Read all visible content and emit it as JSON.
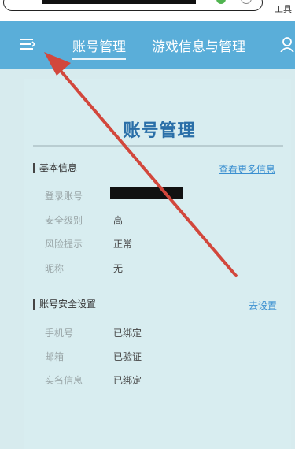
{
  "browser": {
    "tools_label": "工具"
  },
  "header": {
    "tabs": [
      {
        "label": "账号管理"
      },
      {
        "label": "游戏信息与管理"
      }
    ]
  },
  "page": {
    "title": "账号管理"
  },
  "basic_info": {
    "heading": "基本信息",
    "link": "查看更多信息",
    "rows": [
      {
        "label": "登录账号",
        "value": ""
      },
      {
        "label": "安全级别",
        "value": "高"
      },
      {
        "label": "风险提示",
        "value": "正常"
      },
      {
        "label": "昵称",
        "value": "无"
      }
    ]
  },
  "security": {
    "heading": "账号安全设置",
    "link": "去设置",
    "rows": [
      {
        "label": "手机号",
        "value": "已绑定"
      },
      {
        "label": "邮箱",
        "value": "已验证"
      },
      {
        "label": "实名信息",
        "value": "已绑定"
      }
    ]
  },
  "colors": {
    "header_bg": "#5aaed9",
    "page_bg": "#d7ebee",
    "title": "#2a6fa8",
    "link": "#3a8fd0",
    "arrow": "#d2473c"
  },
  "icons": [
    "menu-icon",
    "user-icon"
  ]
}
